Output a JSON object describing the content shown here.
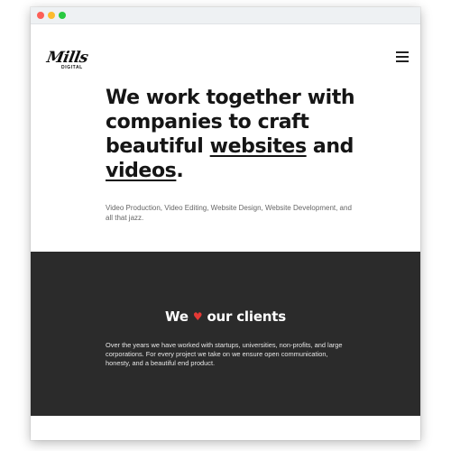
{
  "window": {
    "controls": [
      "close",
      "minimize",
      "maximize"
    ]
  },
  "header": {
    "logo_script": "Mills",
    "logo_sub": "DIGITAL",
    "menu_icon": "hamburger-menu-icon"
  },
  "hero": {
    "heading_part1": "We work together with companies to craft beautiful ",
    "heading_link1": "websites",
    "heading_part2": " and ",
    "heading_link2": "videos",
    "heading_part3": ".",
    "subtitle": "Video Production, Video Editing, Website Design, Website Development, and all that jazz."
  },
  "clients": {
    "heading_before": "We",
    "heart_icon": "heart-icon",
    "heart_glyph": "♥",
    "heading_after": "our clients",
    "body": "Over the years we have worked with startups, universities, non-profits, and large corporations. For every project we take on we ensure open communication, honesty, and a beautiful end product."
  },
  "colors": {
    "dark_section": "#2b2b2b",
    "heart": "#e53935",
    "text": "#151515"
  }
}
